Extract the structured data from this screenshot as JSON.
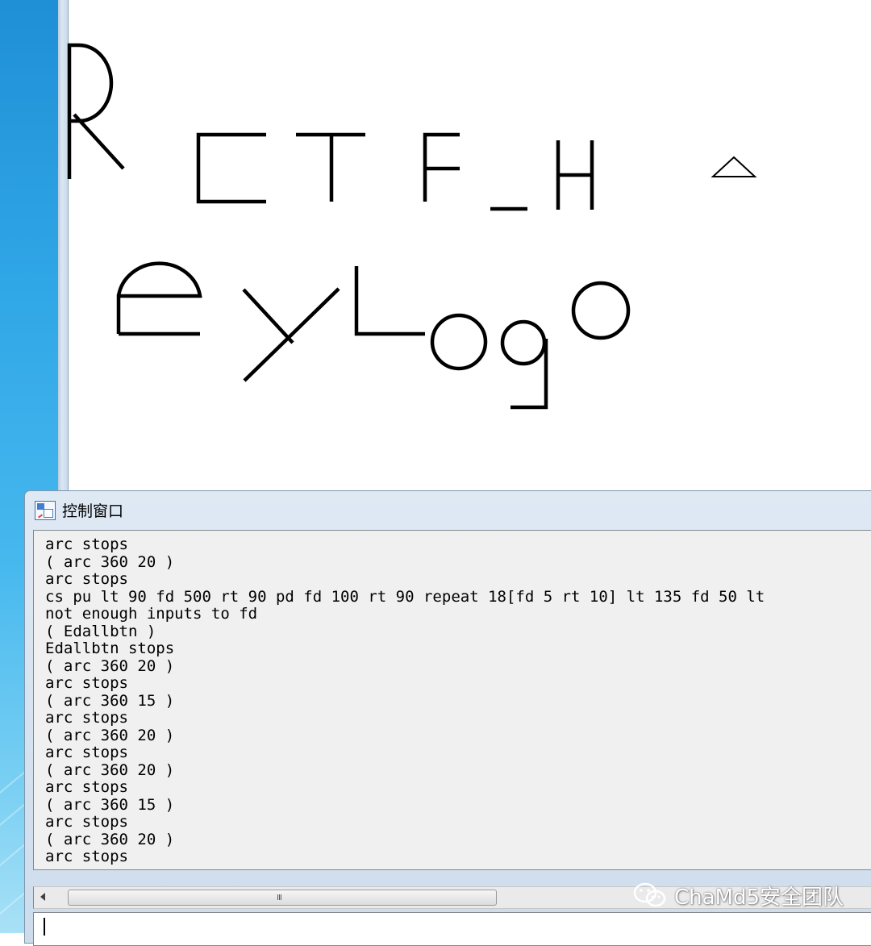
{
  "control_window": {
    "title": "控制窗口",
    "console_lines": [
      "arc stops",
      "( arc 360 20 )",
      "arc stops",
      "cs pu lt 90 fd 500 rt 90 pd fd 100 rt 90 repeat 18[fd 5 rt 10] lt 135 fd 50 lt",
      "not enough inputs to fd",
      "( Edallbtn )",
      "Edallbtn stops",
      "( arc 360 20 )",
      "arc stops",
      "( arc 360 15 )",
      "arc stops",
      "( arc 360 20 )",
      "arc stops",
      "( arc 360 20 )",
      "arc stops",
      "( arc 360 15 )",
      "arc stops",
      "( arc 360 20 )",
      "arc stops"
    ],
    "input_value": "",
    "scrollbar_grip": "III"
  },
  "drawing": {
    "stroke_color": "#000000",
    "text_lettering": [
      "R",
      "CTF_H",
      "eyLogo"
    ]
  },
  "watermark": {
    "text": "ChaMd5安全团队",
    "icon": "wechat-icon"
  },
  "colors": {
    "desktop_blue": "#2fa6e6",
    "console_bg": "#f0f0f0",
    "window_frame": "#cddcec"
  }
}
